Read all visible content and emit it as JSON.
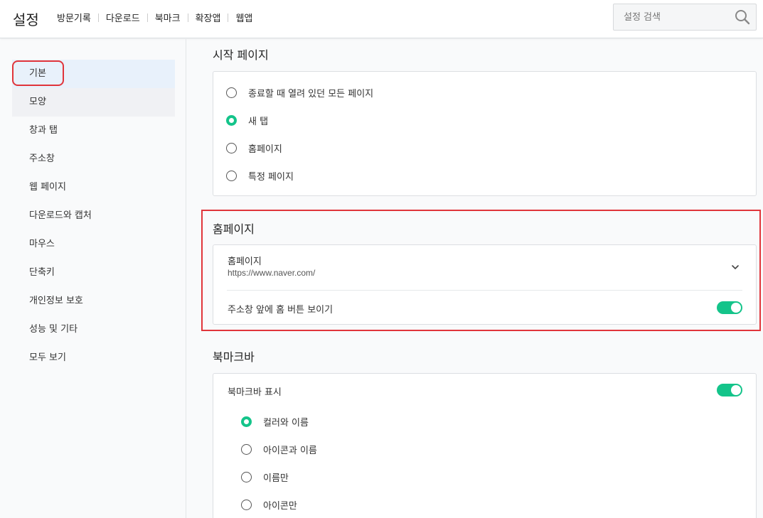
{
  "header": {
    "title": "설정",
    "nav": [
      "방문기록",
      "다운로드",
      "북마크",
      "확장앱",
      "웹앱"
    ],
    "search_placeholder": "설정 검색"
  },
  "sidebar": {
    "items": [
      {
        "label": "기본"
      },
      {
        "label": "모양"
      },
      {
        "label": "창과 탭"
      },
      {
        "label": "주소창"
      },
      {
        "label": "웹 페이지"
      },
      {
        "label": "다운로드와 캡처"
      },
      {
        "label": "마우스"
      },
      {
        "label": "단축키"
      },
      {
        "label": "개인정보 보호"
      },
      {
        "label": "성능 및 기타"
      },
      {
        "label": "모두 보기"
      }
    ],
    "active": "기본"
  },
  "startup": {
    "title": "시작 페이지",
    "options": [
      {
        "label": "종료할 때 열려 있던 모든 페이지",
        "checked": false
      },
      {
        "label": "새 탭",
        "checked": true
      },
      {
        "label": "홈페이지",
        "checked": false
      },
      {
        "label": "특정 페이지",
        "checked": false
      }
    ]
  },
  "homepage": {
    "title": "홈페이지",
    "label": "홈페이지",
    "url": "https://www.naver.com/",
    "show_home_button_label": "주소창 앞에 홈 버튼 보이기",
    "show_home_button": true
  },
  "bookmarkbar": {
    "title": "북마크바",
    "show_label": "북마크바 표시",
    "show": true,
    "options": [
      {
        "label": "컬러와 이름",
        "checked": true
      },
      {
        "label": "아이콘과 이름",
        "checked": false
      },
      {
        "label": "이름만",
        "checked": false
      },
      {
        "label": "아이콘만",
        "checked": false
      }
    ]
  },
  "colors": {
    "accent": "#14c48a",
    "highlight": "#e0353b",
    "active_bg": "#e8f1fb"
  }
}
